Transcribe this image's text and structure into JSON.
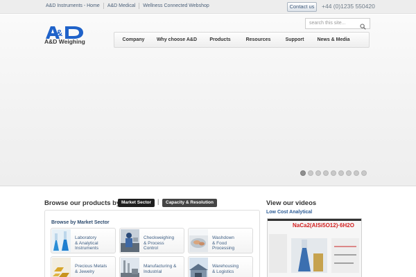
{
  "topbar": {
    "links": [
      "A&D Instruments - Home",
      "A&D Medical",
      "Wellness Connected Webshop"
    ],
    "contact_label": "Contact us",
    "phone": "+44 (0)1235 550420"
  },
  "header": {
    "logo_text": "A&D Weighing",
    "search_placeholder": "search this site...",
    "nav": [
      "Company",
      "Why choose A&D",
      "Products",
      "Resources",
      "Support",
      "News & Media"
    ]
  },
  "slider": {
    "total": 9,
    "active_index": 0
  },
  "browse": {
    "title": "Browse our products by:",
    "filters": [
      {
        "label": "Market Sector",
        "active": true
      },
      {
        "label": "Capacity & Resolution",
        "active": false
      }
    ],
    "separator": "|",
    "heading": "Browse by Market Sector",
    "sectors": [
      {
        "label": "Laboratory\n& Analytical\nInstruments",
        "icon": "lab-flasks-icon"
      },
      {
        "label": "Checkweighing\n& Process\nControl",
        "icon": "checkweighing-icon"
      },
      {
        "label": "Washdown\n& Food\nProcessing",
        "icon": "food-processing-icon"
      },
      {
        "label": "Precious Metals\n& Jewelry",
        "icon": "gold-bars-icon"
      },
      {
        "label": "Manufacturing &\nIndustrial",
        "icon": "factory-icon"
      },
      {
        "label": "Warehousing\n& Logistics",
        "icon": "warehouse-icon"
      }
    ]
  },
  "videos": {
    "title": "View our videos",
    "subtitle": "Low Cost Analytical",
    "thumb_text": "NaCa2(AlSi5O12)·6H2O"
  },
  "colors": {
    "link_blue": "#3f5f84",
    "logo_blue": "#1f62c9",
    "pill_dark": "#2b2b2b",
    "formula_red": "#d21f1f"
  }
}
